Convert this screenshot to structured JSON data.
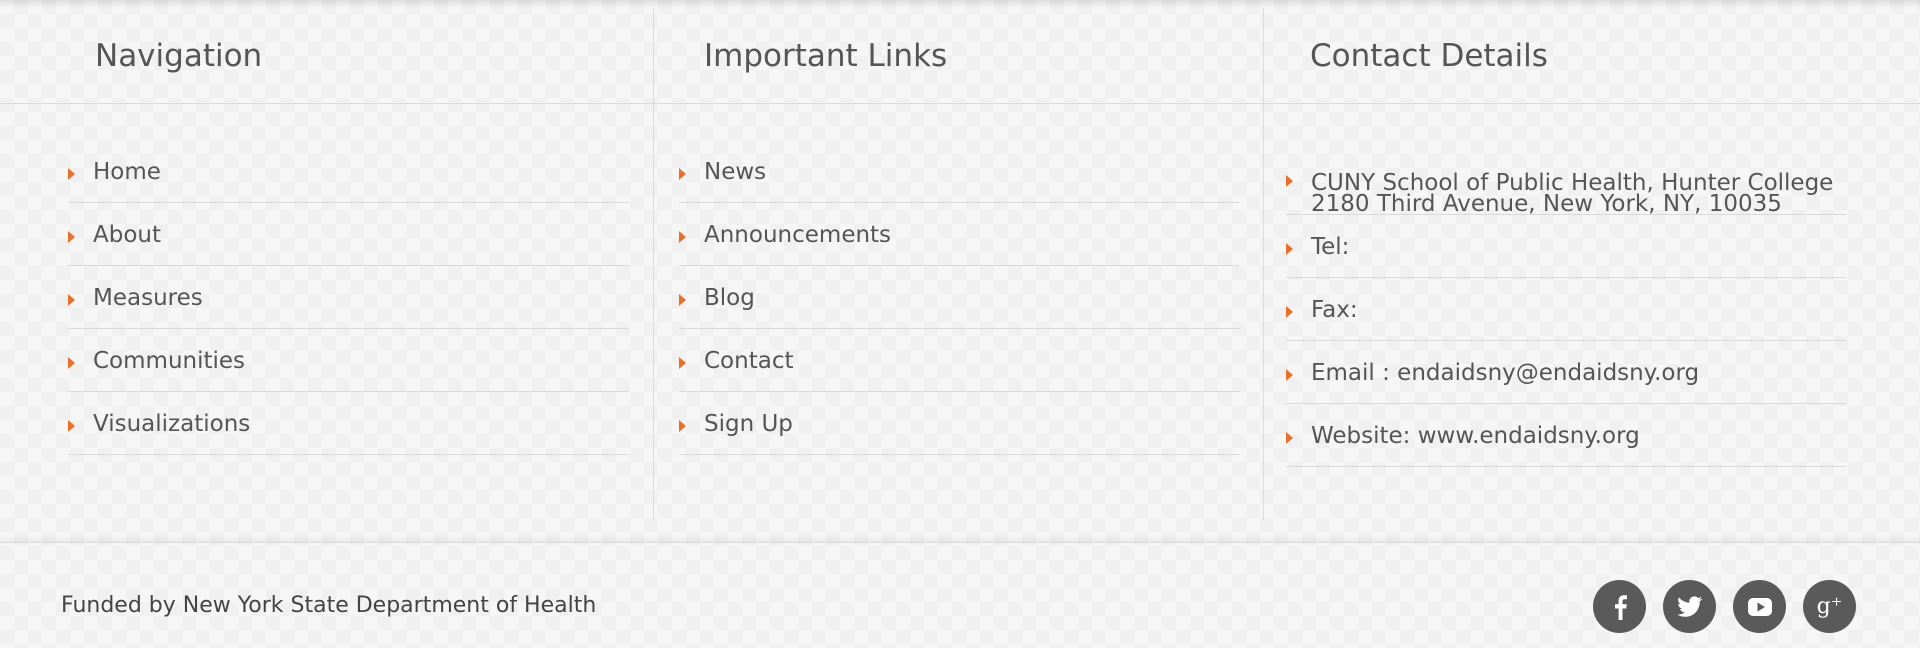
{
  "navigation": {
    "title": "Navigation",
    "items": [
      "Home",
      "About",
      "Measures",
      "Communities",
      "Visualizations"
    ]
  },
  "important_links": {
    "title": "Important Links",
    "items": [
      "News",
      "Announcements",
      "Blog",
      "Contact",
      "Sign Up"
    ]
  },
  "contact": {
    "title": "Contact Details",
    "address_line1": "CUNY School of Public Health, Hunter College",
    "address_line2": "2180 Third Avenue, New York, NY, 10035",
    "tel": "Tel:",
    "fax": "Fax:",
    "email": "Email : endaidsny@endaidsny.org",
    "website": "Website: www.endaidsny.org"
  },
  "footer": {
    "funded_text": "Funded by New York State Department of Health",
    "social_icons": [
      "facebook-icon",
      "twitter-icon",
      "youtube-icon",
      "google-plus-icon"
    ],
    "google_plus_glyph": "g⁺"
  },
  "colors": {
    "accent_arrow": "#e8702a",
    "social_bg": "#5a5a5a"
  }
}
